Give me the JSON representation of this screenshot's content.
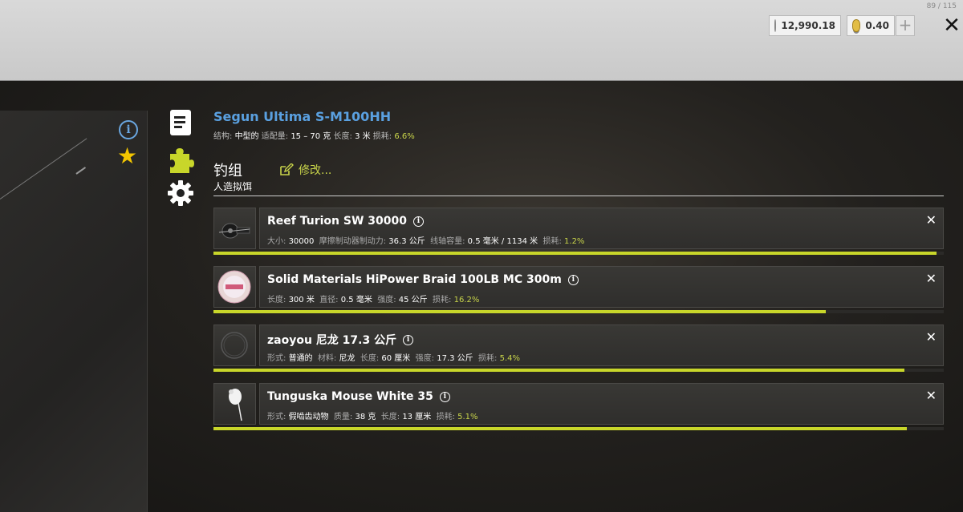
{
  "topbar": {
    "corner_text": "89 / 115",
    "silver": "12,990.18",
    "gold": "0.40",
    "plus": "+",
    "close": "✕"
  },
  "rod": {
    "title": "Segun Ultima S-M100HH",
    "stats": [
      {
        "label": "结构:",
        "value": "中型的"
      },
      {
        "label": "适配量:",
        "value": "15 – 70 克"
      },
      {
        "label": "长度:",
        "value": "3 米"
      },
      {
        "label": "损耗:",
        "value": "6.6%"
      }
    ]
  },
  "rig": {
    "title": "钓组",
    "subtitle": "人造拟饵",
    "edit_label": "修改..."
  },
  "items": [
    {
      "name": "Reef Turion SW 30000",
      "stats": [
        {
          "label": "大小:",
          "value": "30000"
        },
        {
          "label": "摩擦制动器制动力:",
          "value": "36.3 公斤"
        },
        {
          "label": "线轴容量:",
          "value": "0.5 毫米 / 1134 米"
        },
        {
          "label": "损耗:",
          "value": "1.2%"
        }
      ],
      "condition": 0.99
    },
    {
      "name": "Solid Materials HiPower Braid 100LB MC 300m",
      "stats": [
        {
          "label": "长度:",
          "value": "300 米"
        },
        {
          "label": "直径:",
          "value": "0.5 毫米"
        },
        {
          "label": "强度:",
          "value": "45 公斤"
        },
        {
          "label": "损耗:",
          "value": "16.2%"
        }
      ],
      "condition": 0.838
    },
    {
      "name": "zaoyou 尼龙 17.3 公斤",
      "stats": [
        {
          "label": "形式:",
          "value": "普通的"
        },
        {
          "label": "材料:",
          "value": "尼龙"
        },
        {
          "label": "长度:",
          "value": "60 厘米"
        },
        {
          "label": "强度:",
          "value": "17.3 公斤"
        },
        {
          "label": "损耗:",
          "value": "5.4%"
        }
      ],
      "condition": 0.946
    },
    {
      "name": "Tunguska Mouse White 35",
      "stats": [
        {
          "label": "形式:",
          "value": "假啮齿动物"
        },
        {
          "label": "质量:",
          "value": "38 克"
        },
        {
          "label": "长度:",
          "value": "13 厘米"
        },
        {
          "label": "损耗:",
          "value": "5.1%"
        }
      ],
      "condition": 0.949
    }
  ],
  "colors": {
    "accent": "#c8d62a",
    "title_blue": "#5aa0e0",
    "star": "#f3c600"
  }
}
